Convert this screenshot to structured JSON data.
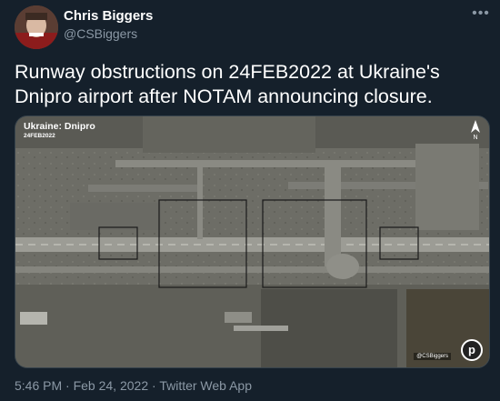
{
  "author": {
    "name": "Chris Biggers",
    "handle": "@CSBiggers"
  },
  "tweet": {
    "text_line1": "Runway obstructions on 24FEB2022 at Ukraine's",
    "text_line2": "Dnipro airport after NOTAM announcing closure."
  },
  "media": {
    "title": "Ukraine: Dnipro",
    "date": "24FEB2022",
    "north_label": "N",
    "credit": "@CSBiggers",
    "logo_letter": "p"
  },
  "meta": {
    "time": "5:46 PM",
    "separator": "·",
    "date": "Feb 24, 2022",
    "source": "Twitter Web App"
  },
  "icons": {
    "more": "more-icon",
    "north": "north-arrow-icon",
    "logo": "planet-logo-icon"
  }
}
